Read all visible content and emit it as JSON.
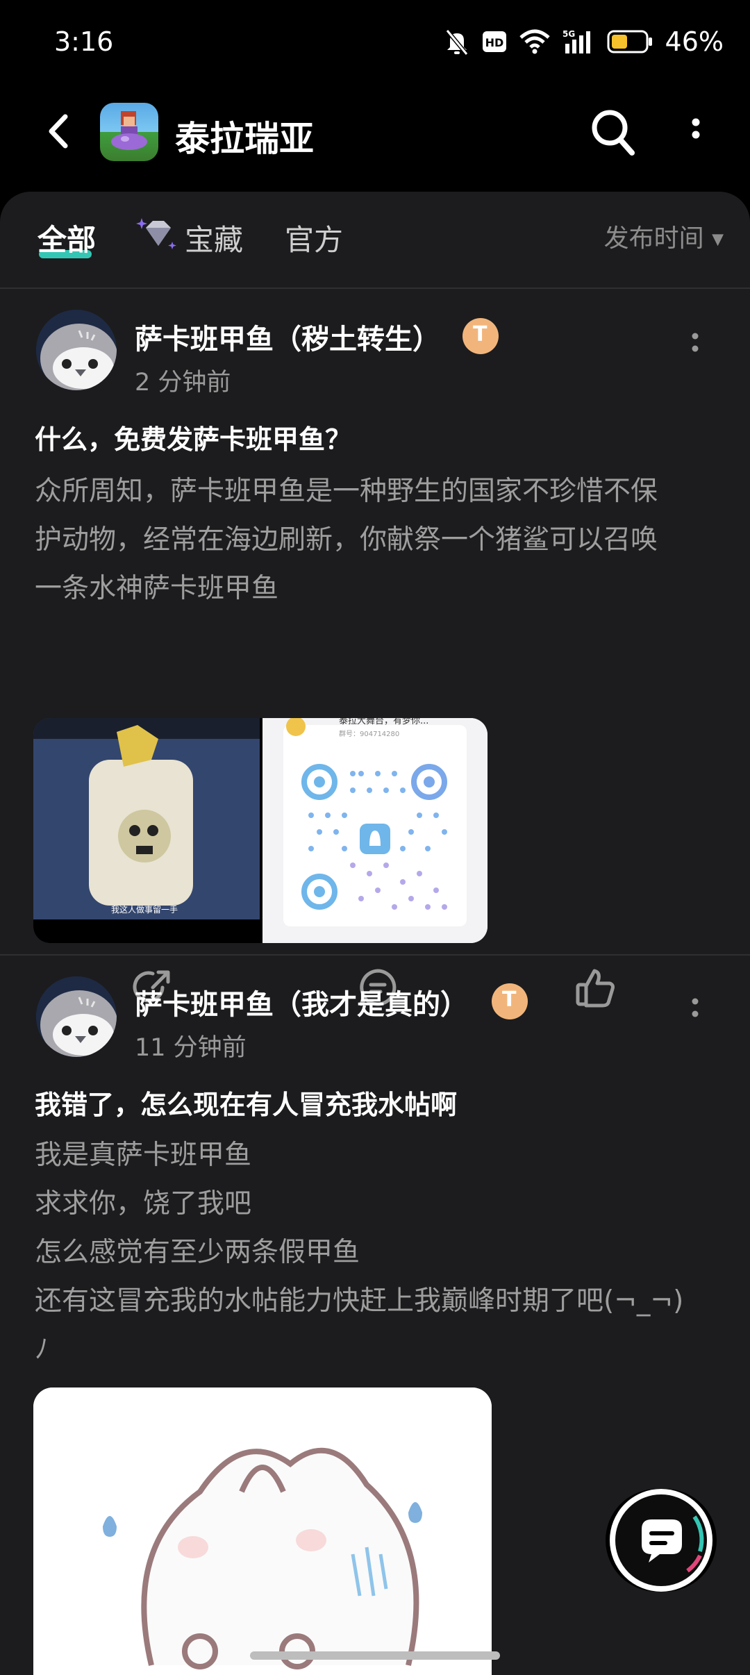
{
  "status_bar": {
    "time": "3:16",
    "battery": "46%"
  },
  "header": {
    "title": "泰拉瑞亚"
  },
  "tabs": {
    "all": "全部",
    "treasure": "宝藏",
    "official": "官方",
    "sort": "发布时间"
  },
  "posts": [
    {
      "author": "萨卡班甲鱼（秽土转生）",
      "badge": "T",
      "time": "2 分钟前",
      "title": "什么，免费发萨卡班甲鱼？",
      "lines": [
        "众所周知，萨卡班甲鱼是一种野生的国家不珍惜不保",
        "护动物，经常在海边刷新，你献祭一个猪鲨可以召唤",
        "一条水神萨卡班甲鱼"
      ],
      "image1_caption": "我这人做事留一手",
      "image2_group": "泰拉大舞台，有梦你...",
      "image2_number": "群号：904714280"
    },
    {
      "author": "萨卡班甲鱼（我才是真的）",
      "badge": "T",
      "time": "11 分钟前",
      "title": "我错了，怎么现在有人冒充我水帖啊",
      "lines": [
        "我是真萨卡班甲鱼",
        "求求你，饶了我吧",
        "怎么感觉有至少两条假甲鱼",
        "还有这冒充我的水帖能力快赶上我巅峰时期了吧(¬_¬)",
        "ﾉ"
      ]
    }
  ],
  "colors": {
    "accent": "#34c6b4",
    "background": "#1c1c1e",
    "badge": "#f1b57b"
  }
}
